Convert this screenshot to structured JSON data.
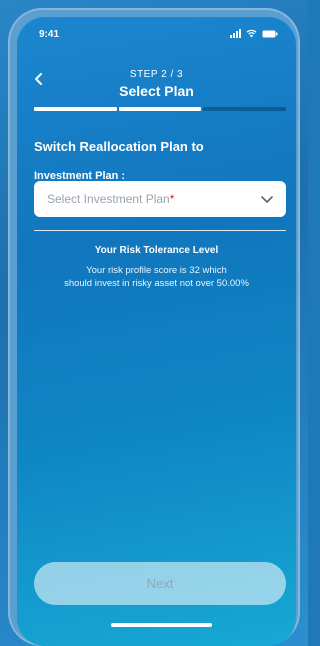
{
  "status_bar": {
    "time": "9:41"
  },
  "header": {
    "step": "STEP 2 / 3",
    "title": "Select Plan",
    "progress": {
      "current": 2,
      "total": 3
    }
  },
  "form": {
    "section_title": "Switch Reallocation Plan to",
    "field_label": "Investment Plan :",
    "select_placeholder": "Select Investment Plan",
    "required_mark": "*"
  },
  "risk": {
    "title": "Your Risk Tolerance Level",
    "line1": "Your risk profile score is 32 which",
    "line2": "should invest in risky asset not over 50.00%"
  },
  "footer": {
    "next_label": "Next",
    "next_enabled": false
  },
  "icons": {
    "back": "chevron-left-icon",
    "select": "chevron-down-icon",
    "signal": "signal-icon",
    "wifi": "wifi-icon",
    "battery": "battery-icon"
  },
  "colors": {
    "background_top": "#1b86cf",
    "background_bottom": "#17a9d4",
    "progress_active": "#ffffff",
    "progress_inactive": "#0b5d9a",
    "required": "#d0253a",
    "button_disabled": "#8fa8b8"
  }
}
